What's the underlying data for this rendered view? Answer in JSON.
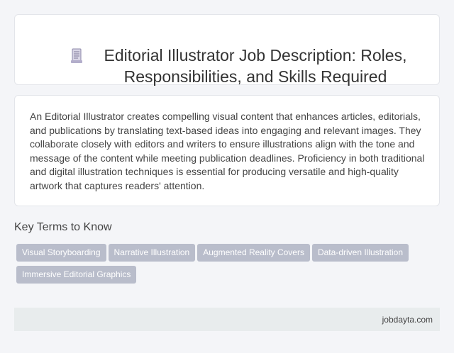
{
  "header": {
    "icon": "document-icon",
    "title": "Editorial Illustrator Job Description: Roles, Responsibilities, and Skills Required"
  },
  "description": {
    "text": "An Editorial Illustrator creates compelling visual content that enhances articles, editorials, and publications by translating text-based ideas into engaging and relevant images. They collaborate closely with editors and writers to ensure illustrations align with the tone and message of the content while meeting publication deadlines. Proficiency in both traditional and digital illustration techniques is essential for producing versatile and high-quality artwork that captures readers' attention."
  },
  "key_terms": {
    "heading": "Key Terms to Know",
    "tags": [
      "Visual Storyboarding",
      "Narrative Illustration",
      "Augmented Reality Covers",
      "Data-driven Illustration",
      "Immersive Editorial Graphics"
    ]
  },
  "footer": {
    "site": "jobdayta.com"
  },
  "colors": {
    "tag_bg": "#b9bdcb",
    "page_bg": "#f4f5f8",
    "footer_bg": "#e8eced"
  }
}
